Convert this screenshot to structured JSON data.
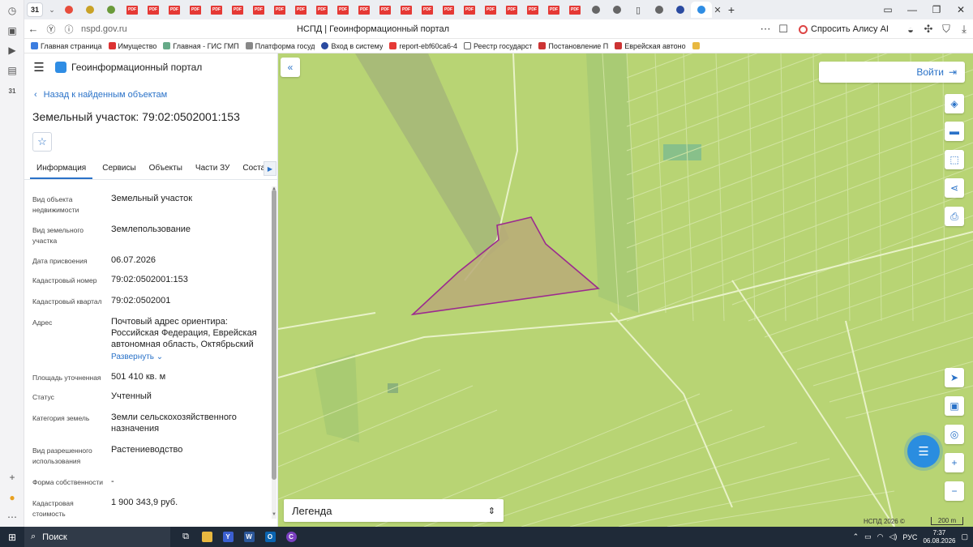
{
  "browser": {
    "tab_count": "31",
    "url": "nspd.gov.ru",
    "page_title": "НСПД | Геоинформационный портал",
    "alice_label": "Спросить Алису AI",
    "bookmarks": [
      {
        "label": "Главная страница",
        "color": "#3b7de0"
      },
      {
        "label": "Имущество",
        "color": "#d33"
      },
      {
        "label": "Главная - ГИС ГМП",
        "color": "#6a8"
      },
      {
        "label": "Платформа госуд",
        "color": "#888"
      },
      {
        "label": "Вход в систему",
        "color": "#2a4aa0"
      },
      {
        "label": "report-ebf60ca6-4",
        "color": "#e53935"
      },
      {
        "label": "Реестр государст",
        "color": "#666"
      },
      {
        "label": "Постановление П",
        "color": "#c33"
      },
      {
        "label": "Еврейская автоно",
        "color": "#c33"
      }
    ]
  },
  "portal": {
    "name": "Геоинформационный портал",
    "back_label": "Назад к найденным объектам",
    "title": "Земельный участок: 79:02:0502001:153",
    "tabs": [
      "Информация",
      "Сервисы",
      "Объекты",
      "Части ЗУ",
      "Состав"
    ],
    "properties": [
      {
        "label": "Вид объекта недвижимости",
        "value": "Земельный участок"
      },
      {
        "label": "Вид земельного участка",
        "value": "Землепользование"
      },
      {
        "label": "Дата присвоения",
        "value": "06.07.2026"
      },
      {
        "label": "Кадастровый номер",
        "value": "79:02:0502001:153"
      },
      {
        "label": "Кадастровый квартал",
        "value": "79:02:0502001"
      },
      {
        "label": "Адрес",
        "value": "Почтовый адрес ориентира: Российская Федерация, Еврейская автономная область, Октябрьский"
      },
      {
        "label": "Площадь уточненная",
        "value": "501 410 кв. м"
      },
      {
        "label": "Статус",
        "value": "Учтенный"
      },
      {
        "label": "Категория земель",
        "value": "Земли сельскохозяйственного назначения"
      },
      {
        "label": "Вид разрешенного использования",
        "value": "Растениеводство"
      },
      {
        "label": "Форма собственности",
        "value": "-"
      },
      {
        "label": "Кадастровая стоимость",
        "value": "1 900 343,9 руб."
      }
    ],
    "expand_label": "Развернуть"
  },
  "map": {
    "login_label": "Войти",
    "legend_label": "Легенда",
    "copyright": "НСПД 2026 ©",
    "scale": "200 m",
    "colors": {
      "land": "#b6d472",
      "parcel_fill": "#b9aa78",
      "parcel_stroke": "#9c2a8f",
      "forest": "#9cc488"
    }
  },
  "taskbar": {
    "search_label": "Поиск",
    "lang": "РУС",
    "time": "7:37",
    "date": "06.08.2026"
  }
}
